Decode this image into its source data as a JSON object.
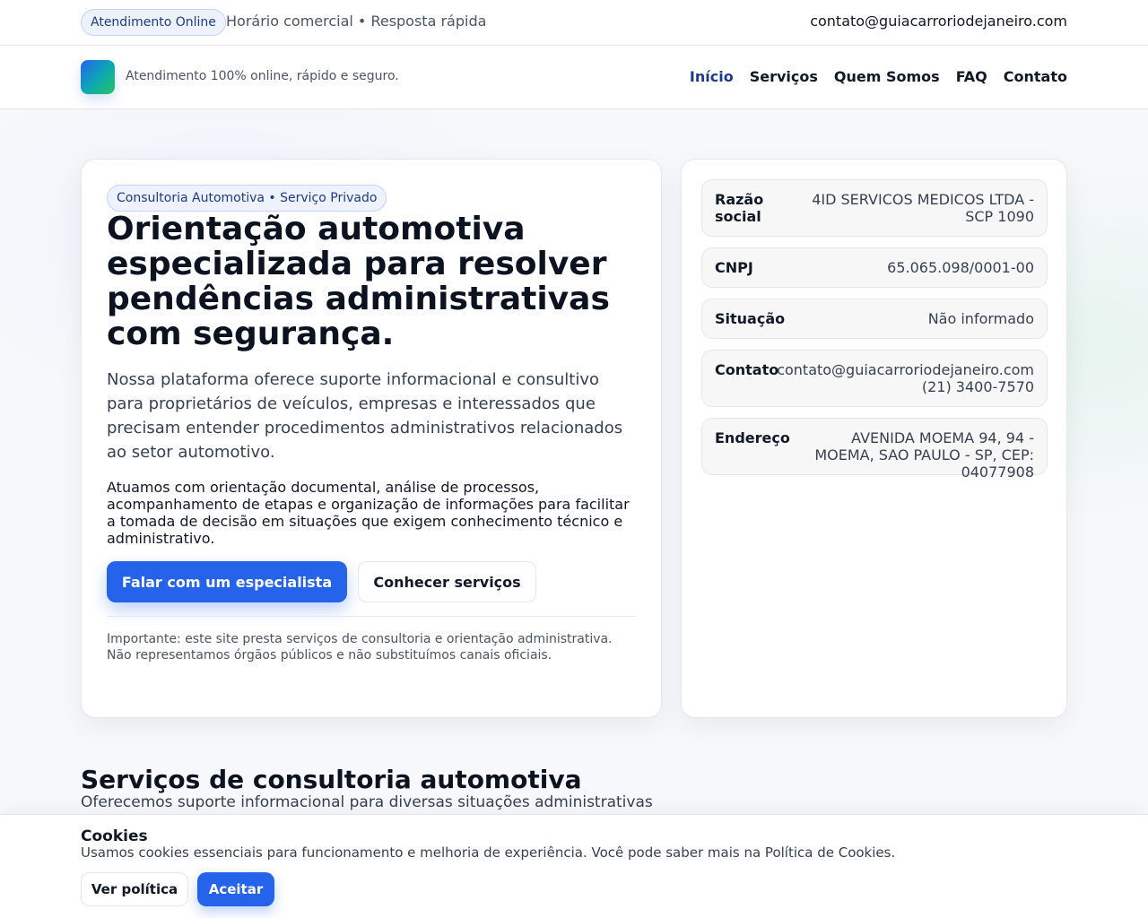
{
  "topbar": {
    "badge": "Atendimento Online",
    "hours": "Horário comercial • Resposta rápida",
    "email": "contato@guiacarroriodejaneiro.com"
  },
  "nav": {
    "tagline": "Atendimento 100% online, rápido e seguro.",
    "links": [
      "Início",
      "Serviços",
      "Quem Somos",
      "FAQ",
      "Contato"
    ],
    "active": "Início"
  },
  "hero": {
    "badge": "Consultoria Automotiva • Serviço Privado",
    "title": "Orientação automotiva especializada para resolver pendências administrativas com segurança.",
    "lead": "Nossa plataforma oferece suporte informacional e consultivo para proprietários de veículos, empresas e interessados que precisam entender procedimentos administrativos relacionados ao setor automotivo.",
    "text": "Atuamos com orientação documental, análise de processos, acompanhamento de etapas e organização de informações para facilitar a tomada de decisão em situações que exigem conhecimento técnico e administrativo.",
    "primary_button": "Falar com um especialista",
    "secondary_button": "Conhecer serviços",
    "note": "Importante: este site presta serviços de consultoria e orientação administrativa. Não representamos órgãos públicos e não substituímos canais oficiais."
  },
  "company": {
    "razao_label": "Razão social",
    "razao_value": "4ID SERVICOS MEDICOS LTDA - SCP 1090",
    "cnpj_label": "CNPJ",
    "cnpj_value": "65.065.098/0001-00",
    "situacao_label": "Situação",
    "situacao_value": "Não informado",
    "contato_label": "Contato",
    "contato_email": "contato@guiacarroriodejaneiro.com",
    "contato_phone": "(21) 3400-7570",
    "endereco_label": "Endereço",
    "endereco_value": "AVENIDA MOEMA 94, 94 - MOEMA, SAO PAULO - SP, CEP: 04077908"
  },
  "services": {
    "title": "Serviços de consultoria automotiva",
    "subtitle": "Oferecemos suporte informacional para diversas situações administrativas"
  },
  "cookies": {
    "title": "Cookies",
    "text": "Usamos cookies essenciais para funcionamento e melhoria de experiência. Você pode saber mais na Política de Cookies.",
    "policy_button": "Ver política",
    "accept_button": "Aceitar"
  },
  "colors": {
    "primary": "#2563eb",
    "accent_green": "#22c55e",
    "navy": "#1e3a8a"
  }
}
